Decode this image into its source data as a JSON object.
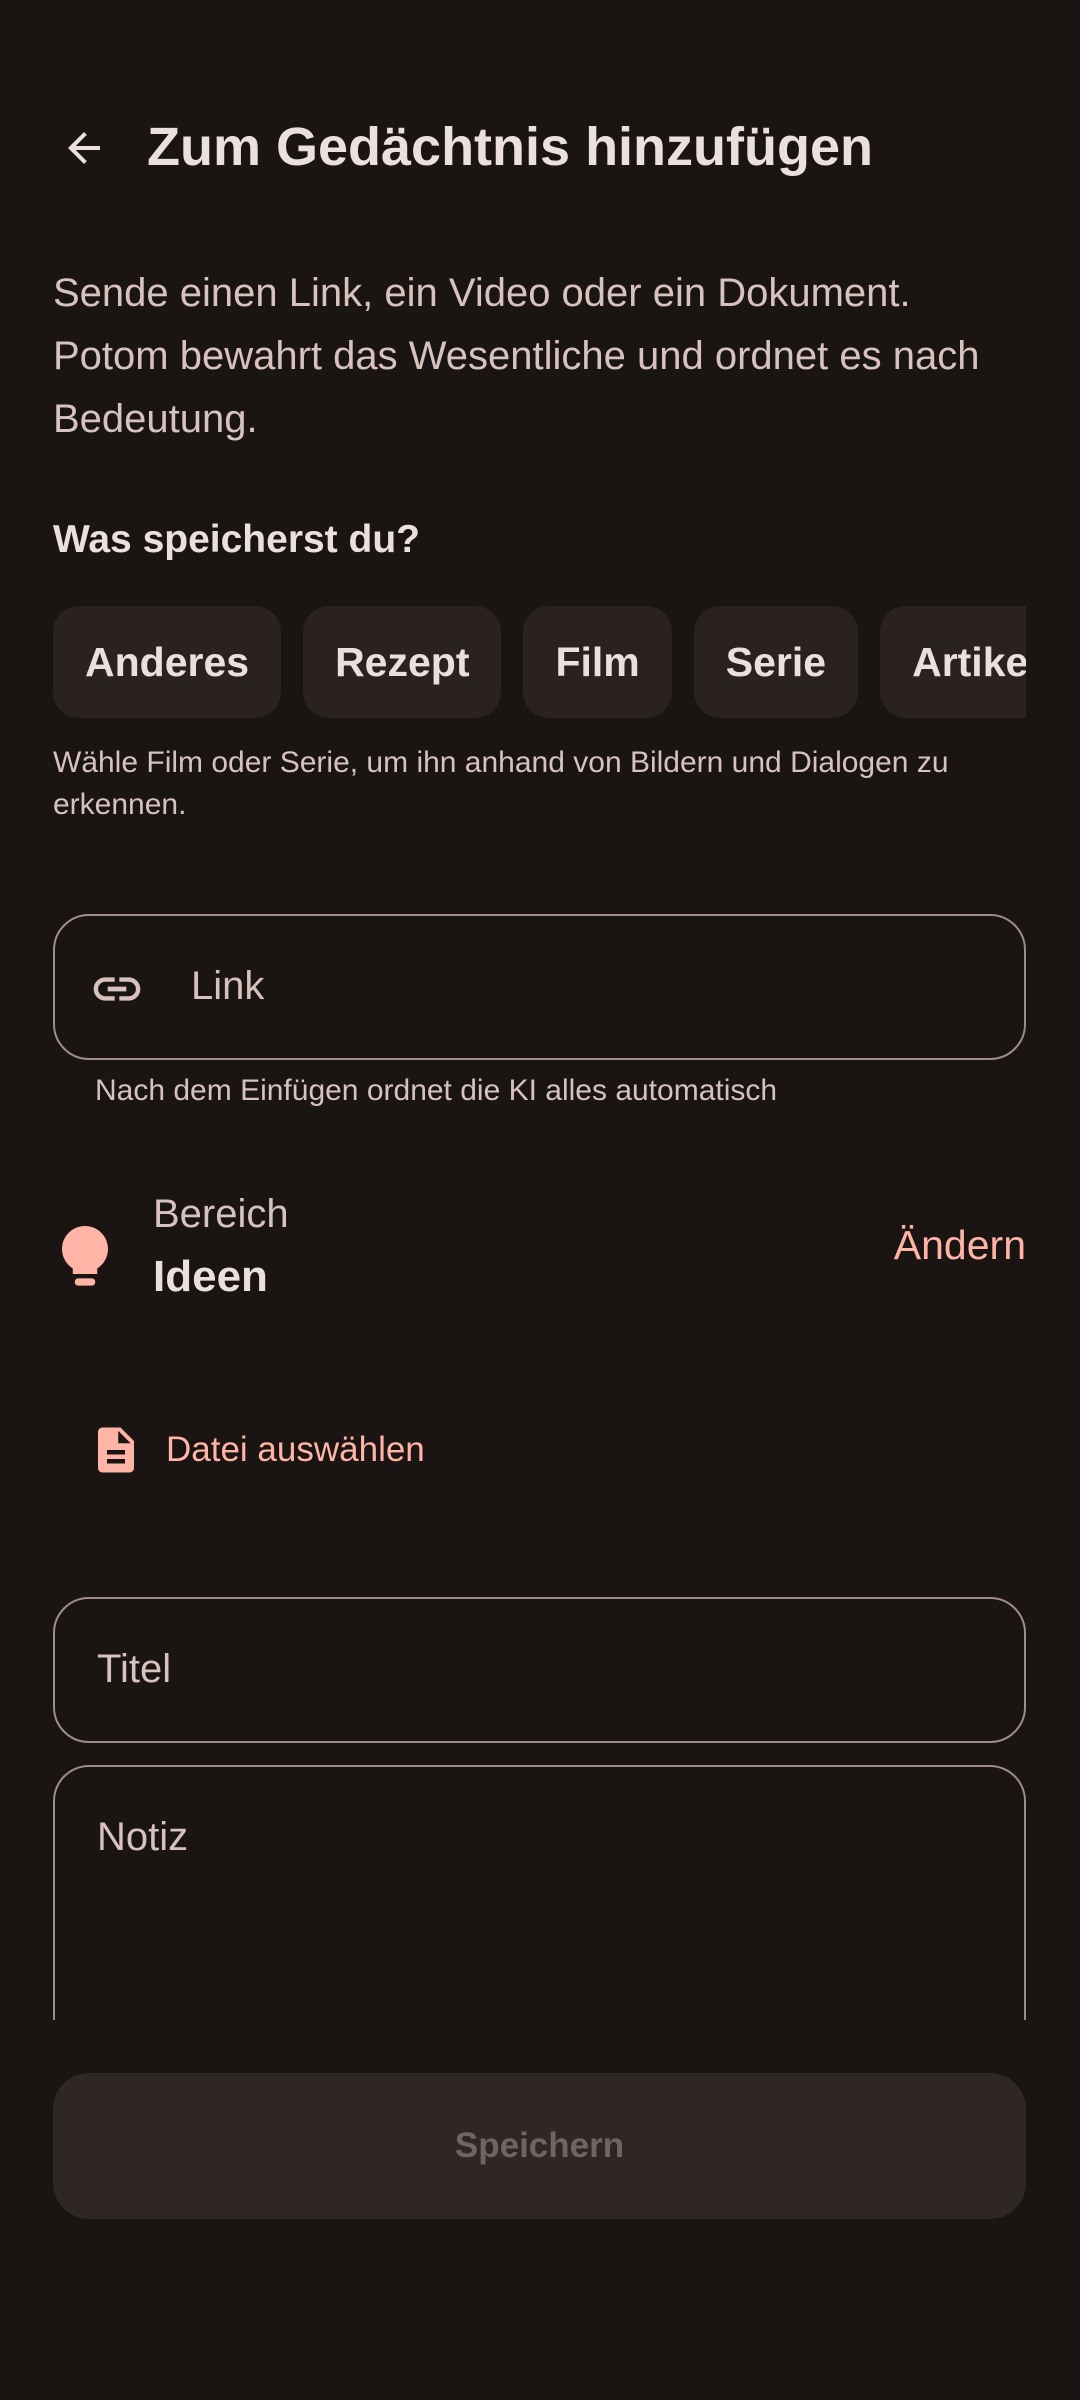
{
  "header": {
    "back_icon": "arrow-back-icon",
    "title": "Zum Gedächtnis hinzufügen"
  },
  "intro": "Sende einen Link, ein Video oder ein Dokument. Potom bewahrt das Wesentliche und ordnet es nach Bedeutung.",
  "category": {
    "label": "Was speicherst du?",
    "chips": [
      "Anderes",
      "Rezept",
      "Film",
      "Serie",
      "Artikel"
    ],
    "hint": "Wähle Film oder Serie, um ihn anhand von Bildern und Dialogen zu erkennen."
  },
  "link_field": {
    "icon": "link-icon",
    "label": "Link",
    "supporting_text": "Nach dem Einfügen ordnet die KI alles automatisch"
  },
  "area": {
    "icon": "lightbulb-icon",
    "label": "Bereich",
    "value": "Ideen",
    "change_label": "Ändern"
  },
  "file_button": {
    "icon": "document-icon",
    "label": "Datei auswählen"
  },
  "title_field": {
    "label": "Titel"
  },
  "note_field": {
    "label": "Notiz"
  },
  "save_button": {
    "label": "Speichern",
    "enabled": false
  },
  "colors": {
    "background": "#1a1413",
    "accent": "#ffb4a6",
    "chip_background": "#2a2220",
    "outline": "#a08c88",
    "disabled_button": "#2e2725"
  }
}
